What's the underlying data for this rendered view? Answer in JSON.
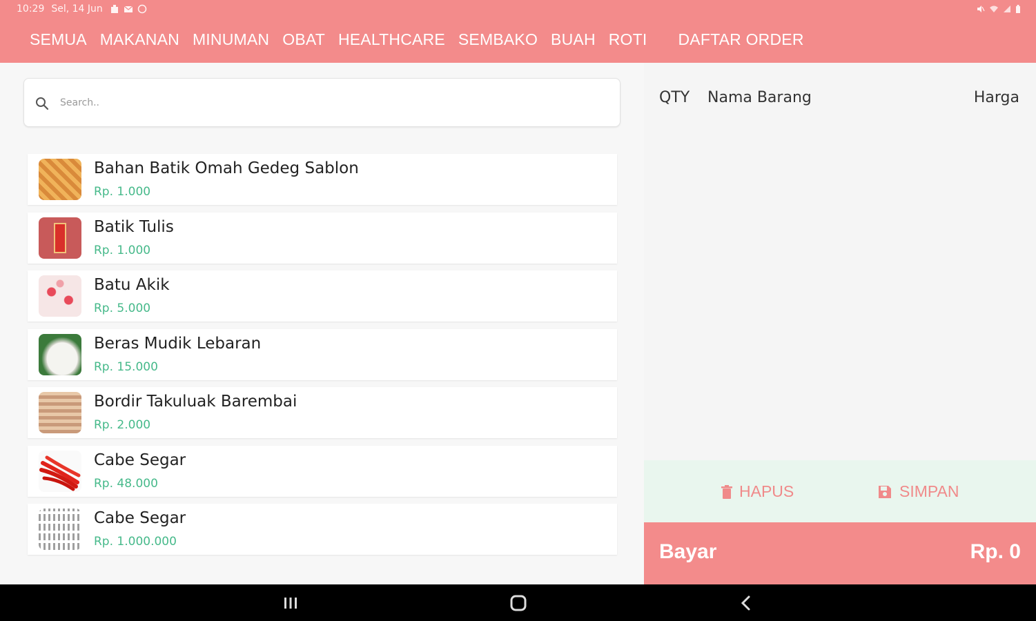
{
  "status_bar": {
    "time": "10:29",
    "date": "Sel, 14 Jun"
  },
  "tabs": [
    {
      "label": "SEMUA"
    },
    {
      "label": "MAKANAN"
    },
    {
      "label": "MINUMAN"
    },
    {
      "label": "OBAT"
    },
    {
      "label": "HEALTHCARE"
    },
    {
      "label": "SEMBAKO"
    },
    {
      "label": "BUAH"
    },
    {
      "label": "ROTI"
    }
  ],
  "order_tab": {
    "label": "DAFTAR ORDER"
  },
  "search": {
    "placeholder": "Search..",
    "icon": "search-icon"
  },
  "products": [
    {
      "name": "Bahan Batik Omah Gedeg Sablon",
      "price": "Rp. 1.000"
    },
    {
      "name": "Batik Tulis",
      "price": "Rp. 1.000"
    },
    {
      "name": "Batu Akik",
      "price": "Rp. 5.000"
    },
    {
      "name": "Beras Mudik Lebaran",
      "price": "Rp. 15.000"
    },
    {
      "name": "Bordir Takuluak Barembai",
      "price": "Rp. 2.000"
    },
    {
      "name": "Cabe Segar",
      "price": "Rp. 48.000"
    },
    {
      "name": "Cabe Segar",
      "price": "Rp. 1.000.000"
    }
  ],
  "order": {
    "col_qty": "QTY",
    "col_name": "Nama Barang",
    "col_price": "Harga",
    "delete_label": "HAPUS",
    "save_label": "SIMPAN",
    "pay_label": "Bayar",
    "total": "Rp. 0"
  },
  "colors": {
    "primary": "#f38b8b",
    "price_green": "#46b98a",
    "action_bg": "#e9f6ee"
  }
}
